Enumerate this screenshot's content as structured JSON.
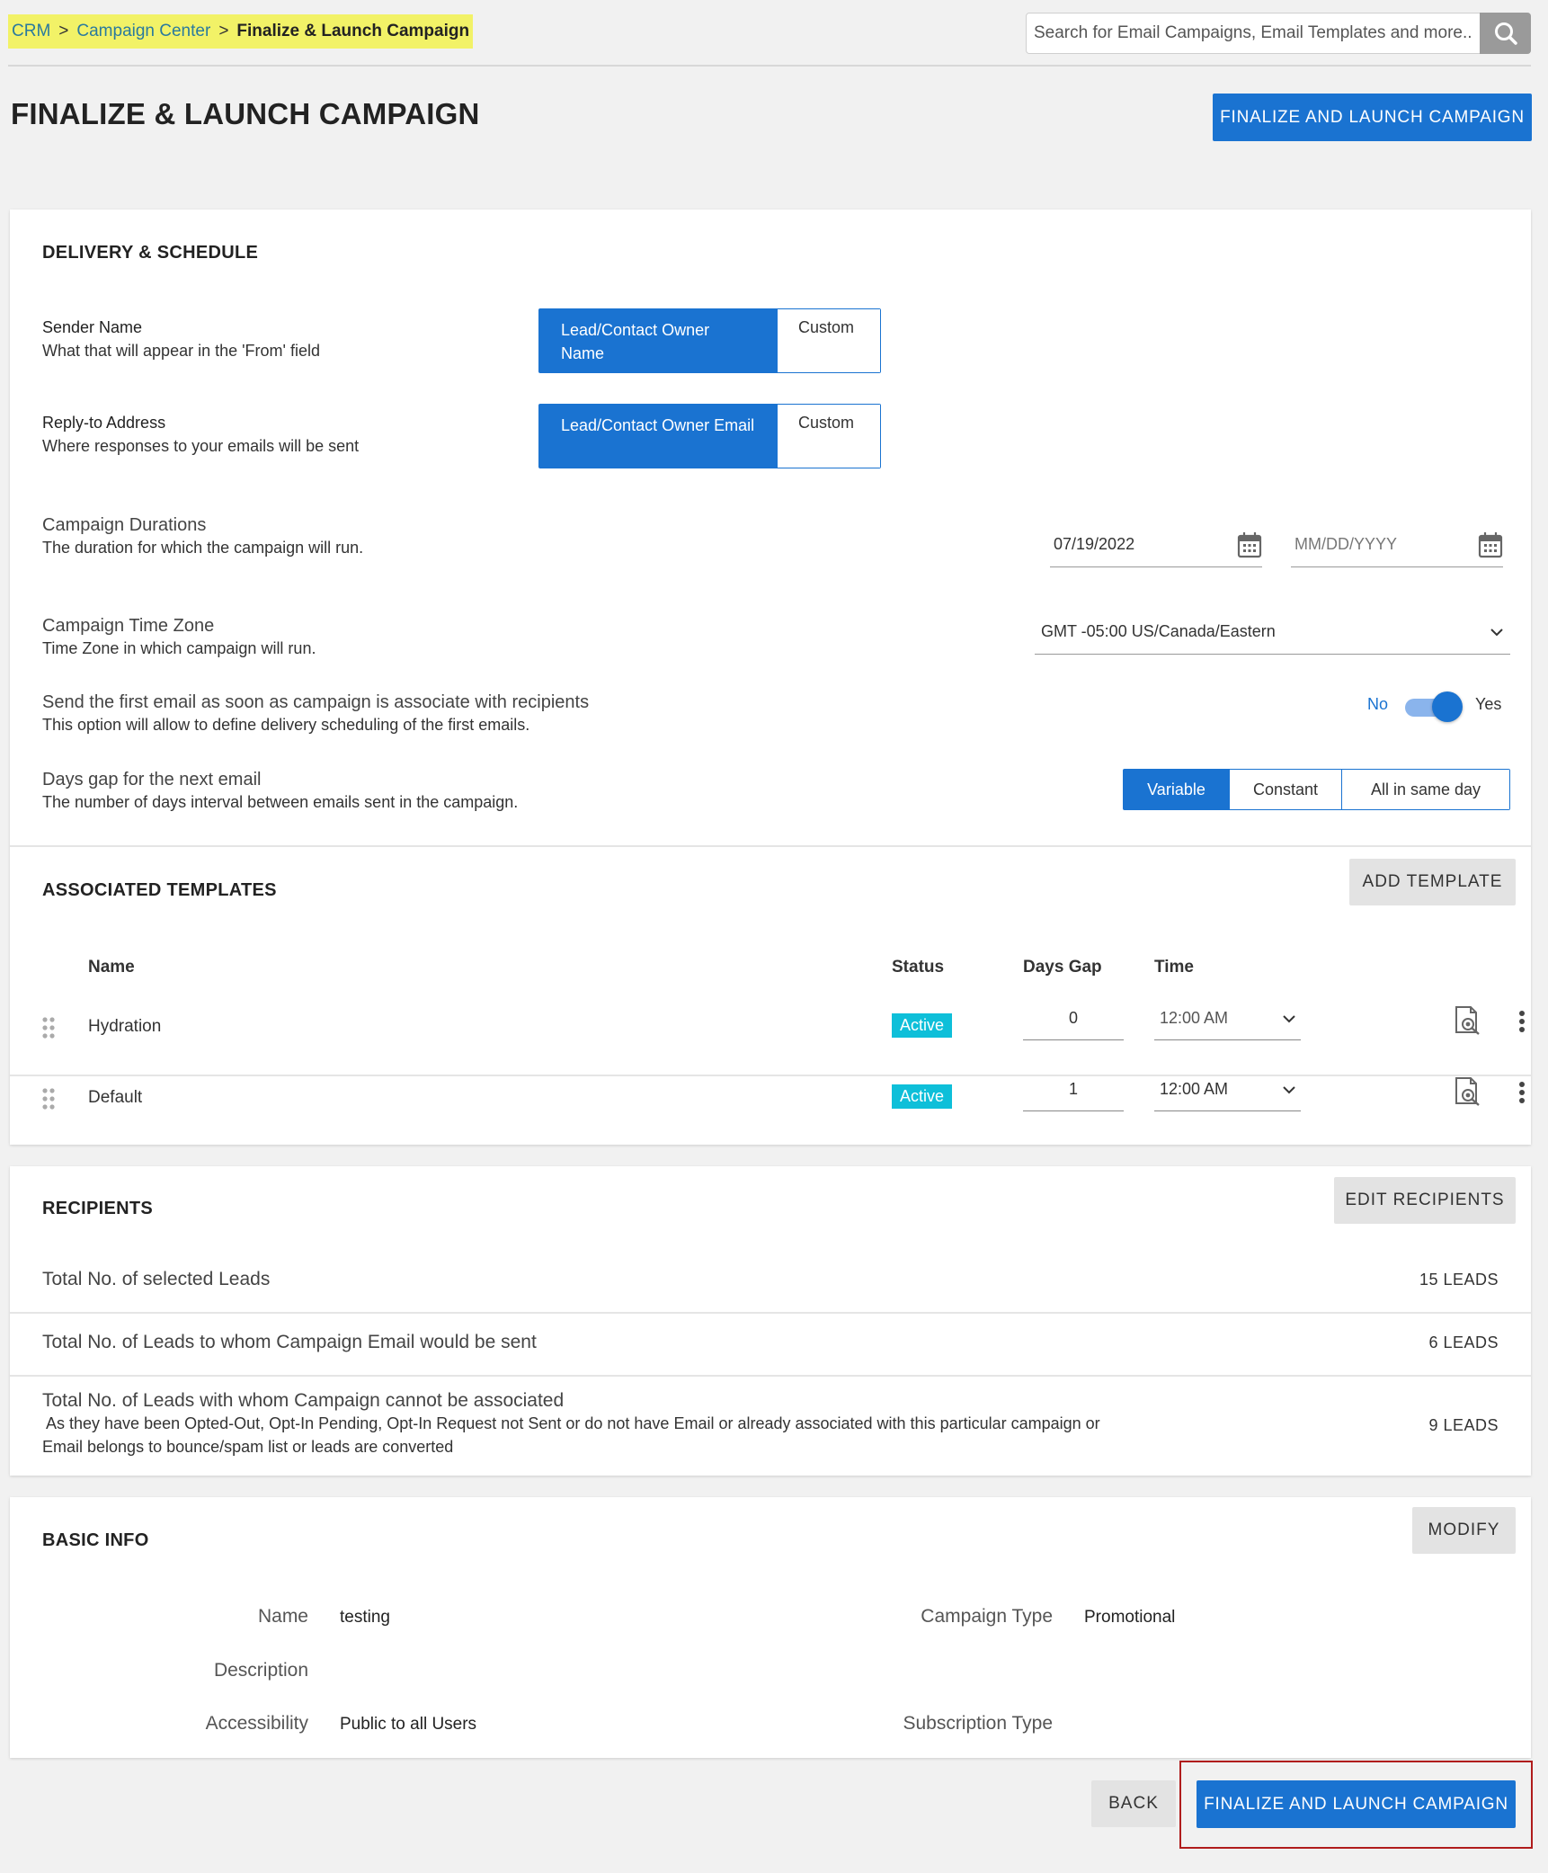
{
  "breadcrumb": {
    "items": [
      "CRM",
      "Campaign Center"
    ],
    "separator": ">",
    "current": "Finalize & Launch Campaign"
  },
  "search": {
    "placeholder": "Search for Email Campaigns, Email Templates and more...",
    "icon": "search-icon"
  },
  "page": {
    "title": "FINALIZE & LAUNCH CAMPAIGN",
    "launch_button": "FINALIZE AND LAUNCH CAMPAIGN"
  },
  "delivery": {
    "title": "DELIVERY & SCHEDULE",
    "sender_name": {
      "label": "Sender Name",
      "desc": "What that will appear in the 'From' field",
      "option_selected": "Lead/Contact Owner Name",
      "option_other": "Custom"
    },
    "reply_to": {
      "label": "Reply-to Address",
      "desc": "Where responses to your emails will be sent",
      "option_selected": "Lead/Contact Owner Email",
      "option_other": "Custom"
    },
    "duration": {
      "label": "Campaign Durations",
      "desc": "The duration for which the campaign will run.",
      "start_value": "07/19/2022",
      "end_placeholder": "MM/DD/YYYY"
    },
    "timezone": {
      "label": "Campaign Time Zone",
      "desc": "Time Zone in which campaign will run.",
      "value": "GMT -05:00 US/Canada/Eastern"
    },
    "first_email": {
      "label": "Send the first email as soon as campaign is associate with recipients",
      "desc": "This option will allow to define delivery scheduling of the first emails.",
      "no_label": "No",
      "yes_label": "Yes",
      "enabled": true
    },
    "days_gap": {
      "label": "Days gap for the next email",
      "desc": "The number of days interval between emails sent in the campaign.",
      "options": [
        "Variable",
        "Constant",
        "All in same day"
      ],
      "selected": "Variable"
    }
  },
  "templates": {
    "title": "ASSOCIATED TEMPLATES",
    "add_button": "ADD TEMPLATE",
    "columns": [
      "Name",
      "Status",
      "Days Gap",
      "Time"
    ],
    "rows": [
      {
        "name": "Hydration",
        "status": "Active",
        "days_gap": "0",
        "time": "12:00 AM"
      },
      {
        "name": "Default",
        "status": "Active",
        "days_gap": "1",
        "time": "12:00 AM"
      }
    ]
  },
  "recipients": {
    "title": "RECIPIENTS",
    "edit_button": "EDIT RECIPIENTS",
    "rows": [
      {
        "label": "Total No. of selected Leads",
        "desc": "",
        "value": "15 LEADS"
      },
      {
        "label": "Total No. of Leads to whom Campaign Email would be sent",
        "desc": "",
        "value": "6 LEADS"
      },
      {
        "label": "Total No. of Leads with whom Campaign cannot be associated",
        "desc_line1": " As they have been Opted-Out, Opt-In Pending, Opt-In Request not Sent or do not have Email or already associated with this particular campaign or",
        "desc_line2": "Email belongs to bounce/spam list or leads are converted",
        "value": "9 LEADS"
      }
    ]
  },
  "basic_info": {
    "title": "BASIC INFO",
    "modify_button": "MODIFY",
    "name_label": "Name",
    "name_value": "testing",
    "description_label": "Description",
    "description_value": "",
    "accessibility_label": "Accessibility",
    "accessibility_value": "Public to all Users",
    "campaign_type_label": "Campaign Type",
    "campaign_type_value": "Promotional",
    "subscription_type_label": "Subscription Type",
    "subscription_type_value": ""
  },
  "footer": {
    "back_button": "BACK",
    "launch_button": "FINALIZE AND LAUNCH CAMPAIGN"
  },
  "colors": {
    "primary": "#1a73d1",
    "active_badge": "#0ebfd9",
    "highlight": "#f2f267",
    "focus_outline": "#b01c1c"
  }
}
